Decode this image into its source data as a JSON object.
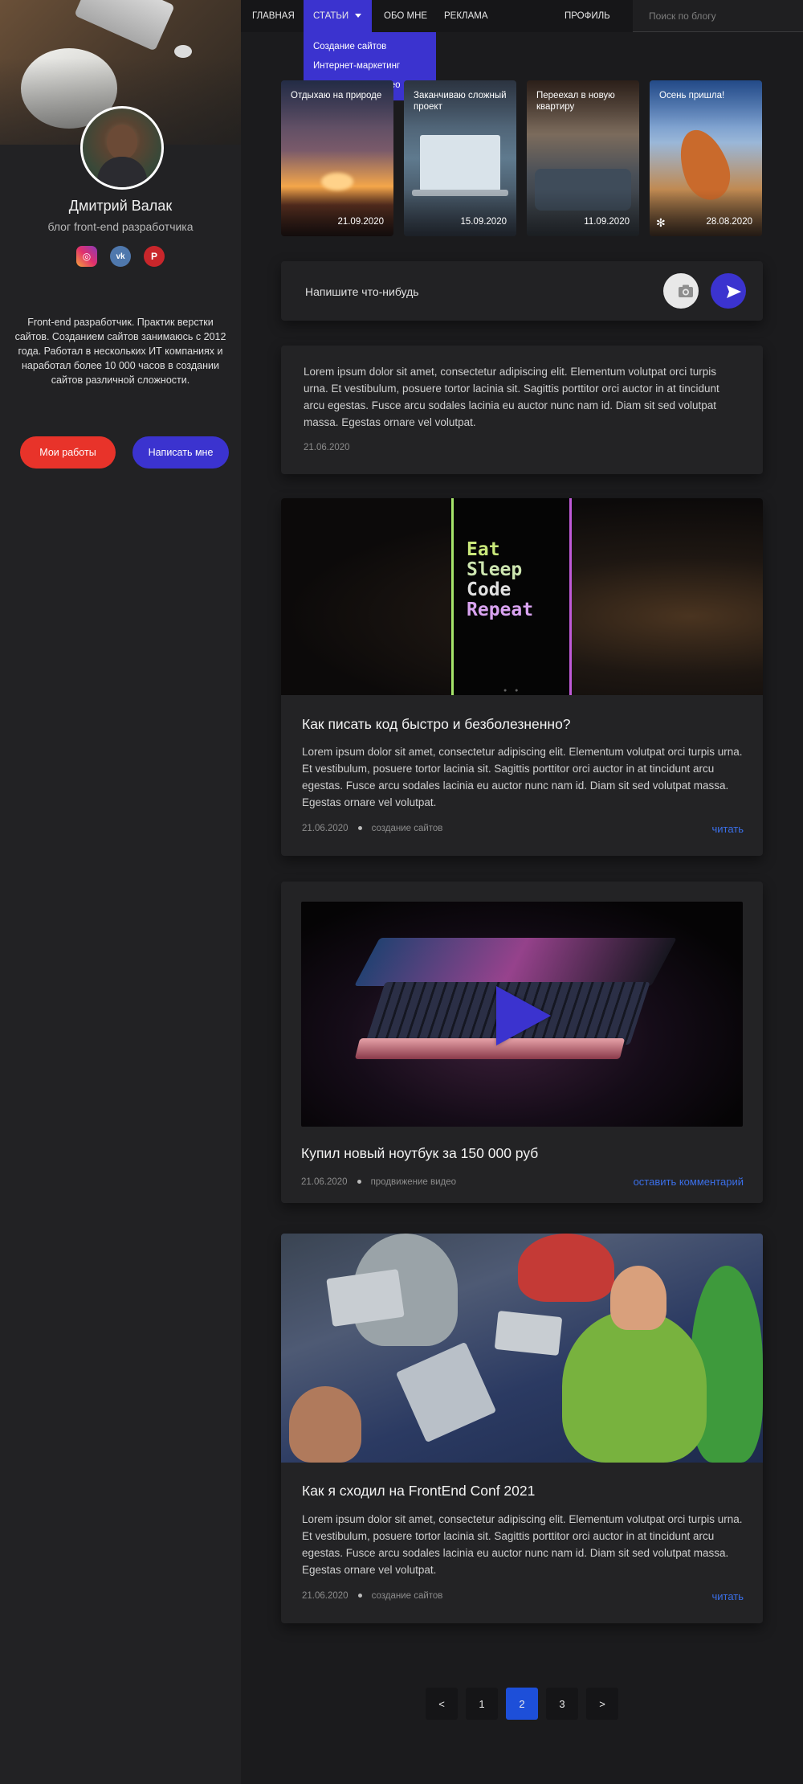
{
  "nav": {
    "home": "ГЛАВНАЯ",
    "articles": "СТАТЬИ",
    "about": "ОБО МНЕ",
    "ads": "РЕКЛАМА",
    "profile": "ПРОФИЛЬ",
    "search_placeholder": "Поиск по блогу",
    "dropdown": [
      "Создание сайтов",
      "Интернет-маркетинг",
      "Продвижение видео"
    ]
  },
  "profile": {
    "name": "Дмитрий Валак",
    "subtitle": "блог front-end разработчика",
    "bio": "Front-end разработчик. Практик верстки сайтов.  Созданием сайтов занимаюсь с 2012 года. Работал в нескольких ИТ компаниях и наработал более 10 000 часов в создании сайтов различной сложности.",
    "works_button": "Мои работы",
    "write_button": "Написать мне",
    "socials": [
      "instagram-icon",
      "vk-icon",
      "pinterest-icon"
    ]
  },
  "stories": [
    {
      "title": "Отдыхаю на природе",
      "date": "21.09.2020"
    },
    {
      "title": "Заканчиваю сложный проект",
      "date": "15.09.2020"
    },
    {
      "title": "Переехал в новую квартиру",
      "date": "11.09.2020"
    },
    {
      "title": "Осень пришла!",
      "date": "28.08.2020"
    }
  ],
  "composer": {
    "placeholder": "Напишите что-нибудь",
    "camera_icon": "camera-icon",
    "send_icon": "send-icon"
  },
  "posts": [
    {
      "text": "Lorem ipsum dolor sit amet, consectetur adipiscing elit. Elementum volutpat orci turpis urna. Et vestibulum, posuere tortor lacinia sit. Sagittis porttitor orci auctor in at tincidunt arcu egestas. Fusce arcu sodales lacinia eu auctor nunc nam id. Diam sit sed volutpat massa. Egestas ornare vel volutpat.",
      "date": "21.06.2020"
    },
    {
      "title": "Как писать код быстро и безболезненно?",
      "text": "Lorem ipsum dolor sit amet, consectetur adipiscing elit. Elementum volutpat orci turpis urna. Et vestibulum, posuere tortor lacinia sit. Sagittis porttitor orci auctor in at tincidunt arcu egestas. Fusce arcu sodales lacinia eu auctor nunc nam id. Diam sit sed volutpat massa. Egestas ornare vel volutpat.",
      "date": "21.06.2020",
      "category": "создание сайтов",
      "link": "читать",
      "image_text": [
        "Eat",
        "Sleep",
        "Code",
        "Repeat"
      ]
    },
    {
      "title": "Купил новый ноутбук за 150 000 руб",
      "date": "21.06.2020",
      "category": "продвижение видео",
      "link": "оставить комментарий"
    },
    {
      "title": "Как я сходил на FrontEnd Conf 2021",
      "text": "Lorem ipsum dolor sit amet, consectetur adipiscing elit. Elementum volutpat orci turpis urna. Et vestibulum, posuere tortor lacinia sit. Sagittis porttitor orci auctor in at tincidunt arcu egestas. Fusce arcu sodales lacinia eu auctor nunc nam id. Diam sit sed volutpat massa. Egestas ornare vel volutpat.",
      "date": "21.06.2020",
      "category": "создание сайтов",
      "link": "читать"
    }
  ],
  "pagination": {
    "prev": "<",
    "pages": [
      "1",
      "2",
      "3"
    ],
    "current": "2",
    "next": ">"
  },
  "colors": {
    "accent": "#3b33cf",
    "red": "#e8332a",
    "link": "#3b6fe8",
    "background": "#1b1b1d",
    "card": "#232325"
  }
}
